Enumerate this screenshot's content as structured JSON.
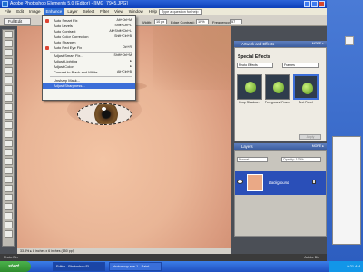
{
  "window": {
    "title": "Adobe Photoshop Elements 5.0 (Editor) - [IMG_7945.JPG]"
  },
  "menubar": {
    "items": [
      "File",
      "Edit",
      "Image",
      "Enhance",
      "Layer",
      "Select",
      "Filter",
      "View",
      "Window",
      "Help"
    ],
    "active_index": 3,
    "help_placeholder": "Type a question for help"
  },
  "options": {
    "full_edit": "Full Edit",
    "width_label": "Width:",
    "width_value": "10 px",
    "edge_contrast_label": "Edge Contrast:",
    "edge_contrast_value": "10%",
    "frequency_label": "Frequency:",
    "frequency_value": "57"
  },
  "enhance_menu": {
    "items": [
      {
        "label": "Auto Smart Fix",
        "shortcut": "Alt+Ctrl+M",
        "highlight": false
      },
      {
        "label": "Auto Levels",
        "shortcut": "Shift+Ctrl+L",
        "highlight": false
      },
      {
        "label": "Auto Contrast",
        "shortcut": "Alt+Shift+Ctrl+L",
        "highlight": false
      },
      {
        "label": "Auto Color Correction",
        "shortcut": "Shift+Ctrl+B",
        "highlight": false
      },
      {
        "label": "Auto Sharpen",
        "shortcut": "",
        "highlight": false
      },
      {
        "label": "Auto Red Eye Fix",
        "shortcut": "Ctrl+R",
        "highlight": false
      },
      {
        "label": "Adjust Smart Fix...",
        "shortcut": "Shift+Ctrl+M",
        "highlight": false
      },
      {
        "label": "Adjust Lighting",
        "shortcut": "▸",
        "highlight": false
      },
      {
        "label": "Adjust Color",
        "shortcut": "▸",
        "highlight": false
      },
      {
        "label": "Convert to Black and White...",
        "shortcut": "Alt+Ctrl+B",
        "highlight": false
      },
      {
        "label": "Unsharp Mask...",
        "shortcut": "",
        "highlight": false
      },
      {
        "label": "Adjust Sharpness...",
        "shortcut": "",
        "highlight": true
      }
    ]
  },
  "effects_panel": {
    "header": "Artwork and Effects",
    "more": "MORE ▸",
    "title": "Special Effects",
    "category": "Photo Effects",
    "subcategory": "Frames",
    "thumbs": [
      "Drop Shadow...",
      "Foreground Frame",
      "Text Panel"
    ],
    "apply": "Apply"
  },
  "layers_panel": {
    "header": "Layers",
    "more": "MORE ▸",
    "mode": "Normal",
    "opacity": "Opacity: 100%",
    "layer_name": "Background"
  },
  "canvas": {
    "status": "33.3% ▸ 8 inches x 6 inches (150 ppi)"
  },
  "photo_bin": {
    "label": "Photo Bin",
    "adobe": "Adobe Bin"
  },
  "taskbar": {
    "start": "start",
    "tasks": [
      "Editor - Photoshop El...",
      "photoshop eye-1 - Paint"
    ],
    "clock": "9:21 AM"
  },
  "colors": {
    "menu_highlight": "#3c6ed8",
    "panel_header": "#4f6fae",
    "layer_selected": "#2a4fb8"
  }
}
